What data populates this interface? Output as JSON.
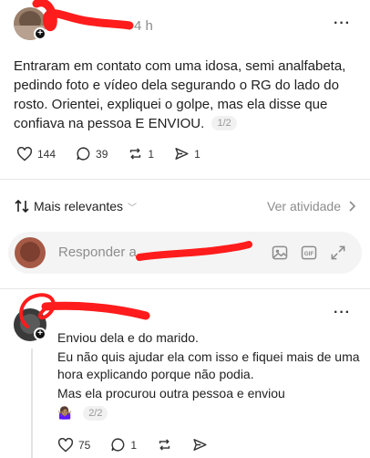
{
  "post": {
    "time": "4 h",
    "body": "Entraram em contato com uma idosa, semi analfabeta, pedindo foto e vídeo dela segurando o RG do lado do rosto. Orientei, expliquei o golpe, mas ela disse que confiava na pessoa E ENVIOU.",
    "page": "1/2",
    "likes": "144",
    "comments": "39",
    "reposts": "1",
    "shares": "1"
  },
  "sort": {
    "label": "Mais relevantes",
    "activity": "Ver atividade"
  },
  "reply": {
    "placeholder": "Responder a",
    "gif_label": "GIF"
  },
  "comment": {
    "lines": [
      "Enviou dela e do marido.",
      "Eu não quis ajudar ela com isso e fiquei mais de uma hora explicando porque não podia.",
      "Mas ela procurou outra pessoa e enviou"
    ],
    "emoji": "🤷🏽‍♀️",
    "page": "2/2",
    "likes": "75",
    "comments": "1"
  },
  "colors": {
    "redaction": "#ff1c1c",
    "muted": "#8c8c8c",
    "text": "#1f1f1f"
  }
}
